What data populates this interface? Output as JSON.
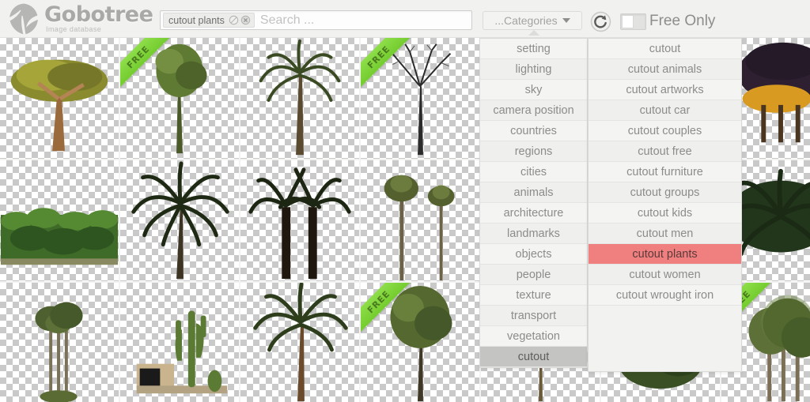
{
  "brand": {
    "title": "Gobotree",
    "subtitle": "Image database",
    "logo_icon": "leaf-tree-icon"
  },
  "search": {
    "token_label": "cutout plants",
    "token_ban_icon": "ban-circle-icon",
    "token_remove_icon": "close-circle-icon",
    "placeholder": "Search ...",
    "value": ""
  },
  "toolbar": {
    "categories_label": "...Categories",
    "categories_caret_icon": "chevron-down-icon",
    "refresh_icon": "refresh-icon",
    "free_only_label": "Free Only",
    "free_only_on": false,
    "accent_selected_color": "#f08080",
    "accent_highlight_color": "#c4c4c2",
    "free_ribbon_color": "#74cc2e"
  },
  "menu_primary": {
    "items": [
      {
        "label": "setting",
        "selected": false
      },
      {
        "label": "lighting",
        "selected": false
      },
      {
        "label": "sky",
        "selected": false
      },
      {
        "label": "camera position",
        "selected": false
      },
      {
        "label": "countries",
        "selected": false
      },
      {
        "label": "regions",
        "selected": false
      },
      {
        "label": "cities",
        "selected": false
      },
      {
        "label": "animals",
        "selected": false
      },
      {
        "label": "architecture",
        "selected": false
      },
      {
        "label": "landmarks",
        "selected": false
      },
      {
        "label": "objects",
        "selected": false
      },
      {
        "label": "people",
        "selected": false
      },
      {
        "label": "texture",
        "selected": false
      },
      {
        "label": "transport",
        "selected": false
      },
      {
        "label": "vegetation",
        "selected": false
      },
      {
        "label": "cutout",
        "selected": true
      }
    ]
  },
  "menu_secondary": {
    "items": [
      {
        "label": "cutout",
        "selected": false
      },
      {
        "label": "cutout animals",
        "selected": false
      },
      {
        "label": "cutout artworks",
        "selected": false
      },
      {
        "label": "cutout car",
        "selected": false
      },
      {
        "label": "cutout couples",
        "selected": false
      },
      {
        "label": "cutout free",
        "selected": false
      },
      {
        "label": "cutout furniture",
        "selected": false
      },
      {
        "label": "cutout groups",
        "selected": false
      },
      {
        "label": "cutout kids",
        "selected": false
      },
      {
        "label": "cutout men",
        "selected": false
      },
      {
        "label": "cutout plants",
        "selected": true
      },
      {
        "label": "cutout women",
        "selected": false
      },
      {
        "label": "cutout wrought iron",
        "selected": false
      }
    ]
  },
  "grid": {
    "columns": 7,
    "rows": 3,
    "free_badge_label": "FREE",
    "items": [
      {
        "subject": "umbrella-acacia-tree",
        "free": false
      },
      {
        "subject": "slender-green-tree",
        "free": true
      },
      {
        "subject": "tall-palm-tree",
        "free": false
      },
      {
        "subject": "bare-winter-tree",
        "free": true
      },
      {
        "subject": "leafy-shrub",
        "free": false
      },
      {
        "subject": "dark-broadleaf-tree",
        "free": false
      },
      {
        "subject": "sunlit-palm-cluster",
        "free": false
      },
      {
        "subject": "banana-plantation-row",
        "free": false
      },
      {
        "subject": "fan-palm-tree",
        "free": false
      },
      {
        "subject": "twin-date-palms",
        "free": false
      },
      {
        "subject": "two-slim-palms",
        "free": false
      },
      {
        "subject": "dense-bush",
        "free": false
      },
      {
        "subject": "small-palm-tree",
        "free": false
      },
      {
        "subject": "wide-fan-palm",
        "free": false
      },
      {
        "subject": "palm-trio-cluster",
        "free": false
      },
      {
        "subject": "cactus-with-wall",
        "free": false
      },
      {
        "subject": "single-date-palm",
        "free": false
      },
      {
        "subject": "young-leafy-tree",
        "free": true
      },
      {
        "subject": "bare-sapling",
        "free": false
      },
      {
        "subject": "shrub-cluster",
        "free": false
      },
      {
        "subject": "eucalyptus-grove",
        "free": true
      }
    ]
  }
}
